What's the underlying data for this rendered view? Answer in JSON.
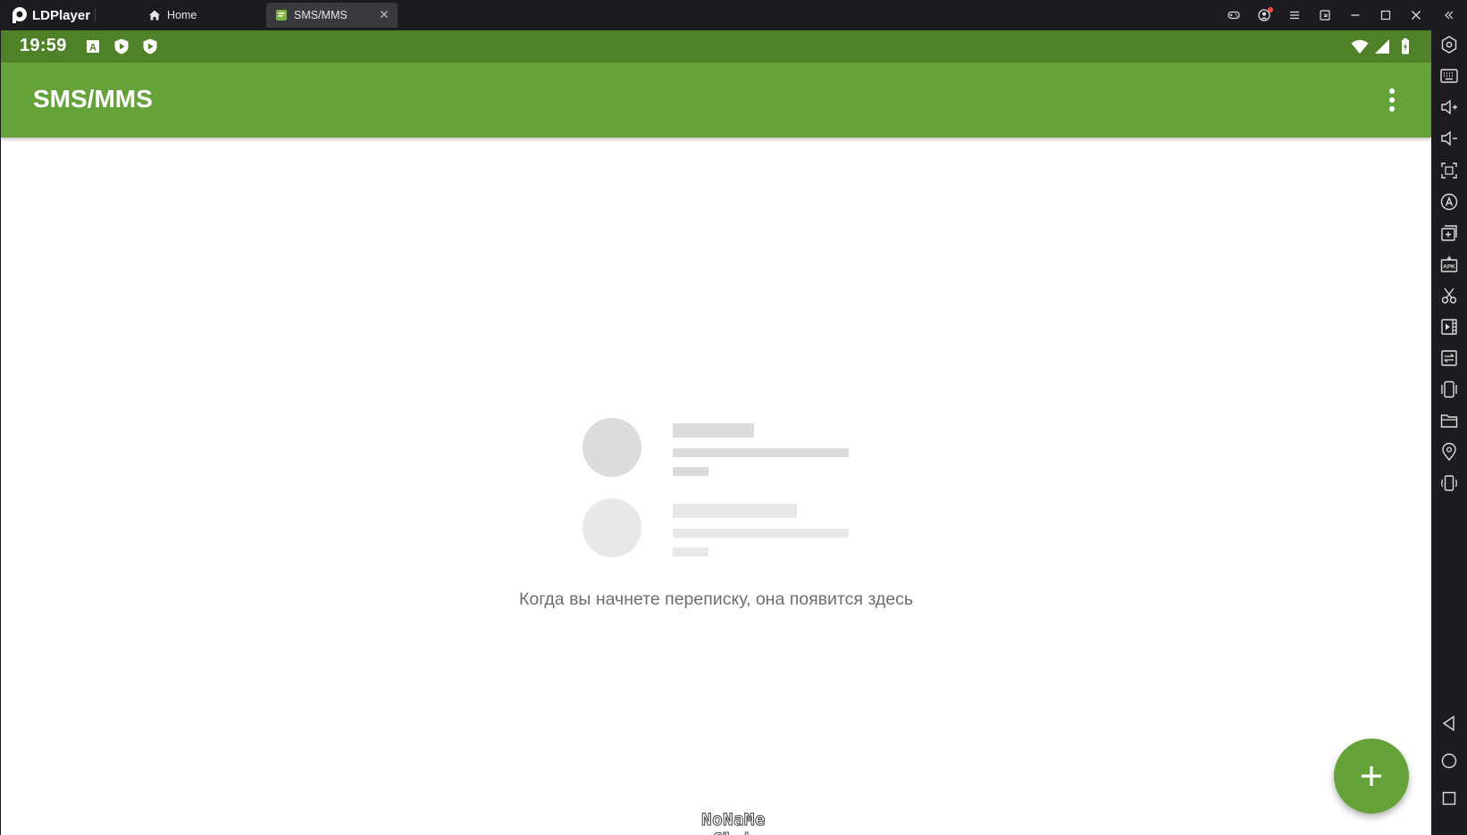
{
  "window": {
    "app_name": "LDPlayer",
    "tabs": [
      {
        "label": "Home",
        "icon": "home-icon",
        "active": false
      },
      {
        "label": "SMS/MMS",
        "icon": "sms-app-icon",
        "active": true
      }
    ],
    "controls": [
      "gamepad-icon",
      "account-icon",
      "menu-icon",
      "restore-down-icon",
      "minimize-icon",
      "maximize-icon",
      "close-icon",
      "collapse-sidebar-icon"
    ]
  },
  "statusbar": {
    "time": "19:59",
    "left_icons": [
      "keyboard-a-icon",
      "play-protect-icon",
      "play-protect-icon"
    ],
    "right_icons": [
      "wifi-icon",
      "signal-icon",
      "battery-charging-icon"
    ]
  },
  "appbar": {
    "title": "SMS/MMS",
    "menu_icon": "more-vert-icon"
  },
  "empty_state": {
    "message": "Когда вы начнете переписку, она появится здесь"
  },
  "fab": {
    "icon": "plus-icon"
  },
  "watermark": "NoNaMe Club",
  "sidebar_tools": [
    "settings-icon",
    "keyboard-icon",
    "volume-up-icon",
    "volume-down-icon",
    "fullscreen-icon",
    "operation-record-icon",
    "add-instance-icon",
    "apk-install-icon",
    "scissors-icon",
    "video-record-icon",
    "sync-icon",
    "shake-icon",
    "folder-icon",
    "location-icon",
    "rotate-icon"
  ],
  "nav_buttons": [
    "back-icon",
    "home-circle-icon",
    "recents-icon"
  ],
  "colors": {
    "statusbar": "#4f8128",
    "appbar": "#66a23a",
    "fab": "#66a23a",
    "chrome": "#1c1c20"
  }
}
